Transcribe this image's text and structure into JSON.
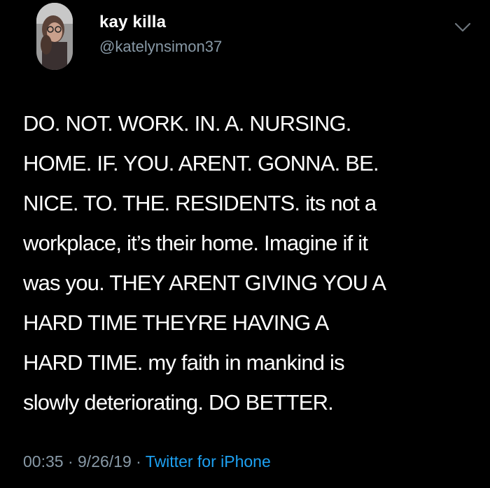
{
  "author": {
    "display_name": "kay killa",
    "handle": "@katelynsimon37"
  },
  "tweet": {
    "text": "DO. NOT. WORK. IN. A. NURSING.\nHOME. IF. YOU. ARENT. GONNA. BE.\nNICE. TO. THE. RESIDENTS. its not a\nworkplace, it’s their home. Imagine if it\nwas you. THEY ARENT GIVING YOU A\nHARD TIME THEYRE HAVING A\nHARD TIME. my faith in mankind is\nslowly deteriorating. DO BETTER."
  },
  "meta": {
    "time": "00:35",
    "separator_1": " · ",
    "date": "9/26/19",
    "separator_2": " · ",
    "source": "Twitter for iPhone"
  },
  "icons": {
    "menu": "chevron-down-icon"
  },
  "colors": {
    "background": "#000000",
    "text": "#ffffff",
    "secondary_text": "#8899a6",
    "link": "#1da1f2"
  }
}
